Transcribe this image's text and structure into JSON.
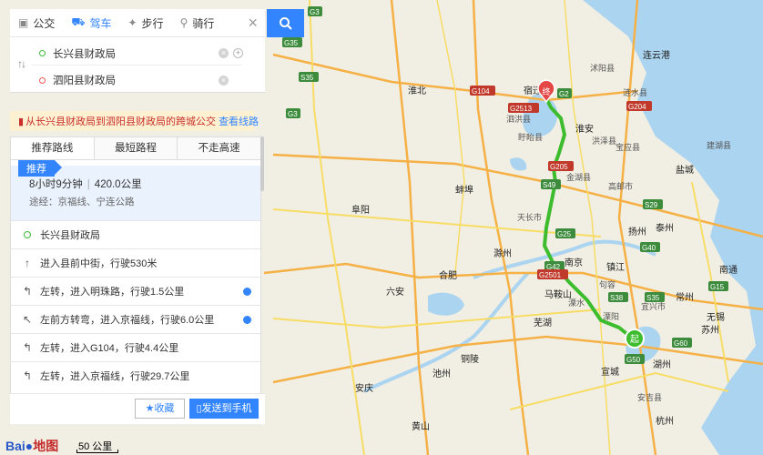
{
  "tabs": [
    {
      "label": "公交",
      "icon": "bus-icon",
      "active": false
    },
    {
      "label": "驾车",
      "icon": "car-icon",
      "active": true
    },
    {
      "label": "步行",
      "icon": "walk-icon",
      "active": false
    },
    {
      "label": "骑行",
      "icon": "bike-icon",
      "active": false
    }
  ],
  "origin": "长兴县财政局",
  "destination": "泗阳县财政局",
  "notice": {
    "text": "从长兴县财政局到泗阳县财政局的跨城公交",
    "link": "查看线路"
  },
  "route_options": [
    "推荐路线",
    "最短路程",
    "不走高速"
  ],
  "recommended": {
    "badge": "推荐",
    "duration": "8小时9分钟",
    "distance": "420.0公里",
    "via": "途经：京福线、宁连公路"
  },
  "steps": [
    {
      "text": "长兴县财政局",
      "icon": "start-dot"
    },
    {
      "text": "进入县前中街，行驶530米",
      "icon": "arrow-up-icon"
    },
    {
      "text": "左转，进入明珠路，行驶1.5公里",
      "icon": "turn-left-icon"
    },
    {
      "text": "左前方转弯，进入京福线，行驶6.0公里",
      "icon": "turn-left-front-icon"
    },
    {
      "text": "左转，进入G104，行驶4.4公里",
      "icon": "turn-left-icon"
    },
    {
      "text": "左转，进入京福线，行驶29.7公里",
      "icon": "turn-left-icon"
    }
  ],
  "actions": {
    "favorite": "收藏",
    "send": "发送到手机"
  },
  "logo": {
    "text": "Bai",
    "text2": "地图"
  },
  "scale": "50 公里",
  "markers": {
    "start": "起",
    "end": "终"
  },
  "map_labels": [
    {
      "text": "南京",
      "kind": "city"
    },
    {
      "text": "镇江",
      "kind": "city"
    },
    {
      "text": "常州",
      "kind": "city"
    },
    {
      "text": "无锡",
      "kind": "city"
    },
    {
      "text": "苏州",
      "kind": "city"
    },
    {
      "text": "扬州",
      "kind": "city"
    },
    {
      "text": "泰州",
      "kind": "city"
    },
    {
      "text": "马鞍山",
      "kind": "city"
    },
    {
      "text": "芜湖",
      "kind": "city"
    },
    {
      "text": "合肥",
      "kind": "city"
    },
    {
      "text": "淮安",
      "kind": "city"
    },
    {
      "text": "宿迁",
      "kind": "city"
    },
    {
      "text": "盐城",
      "kind": "city"
    },
    {
      "text": "阜阳",
      "kind": "city"
    },
    {
      "text": "蚌埠",
      "kind": "city"
    },
    {
      "text": "滁州",
      "kind": "city"
    },
    {
      "text": "湖州",
      "kind": "city"
    },
    {
      "text": "杭州",
      "kind": "city"
    },
    {
      "text": "宣城",
      "kind": "city"
    },
    {
      "text": "六安",
      "kind": "city"
    },
    {
      "text": "安庆",
      "kind": "city"
    },
    {
      "text": "铜陵",
      "kind": "city"
    },
    {
      "text": "池州",
      "kind": "city"
    },
    {
      "text": "黄山",
      "kind": "city"
    },
    {
      "text": "南通",
      "kind": "city"
    },
    {
      "text": "淮北",
      "kind": "city"
    },
    {
      "text": "泗洪县",
      "kind": "town"
    },
    {
      "text": "盱眙县",
      "kind": "town"
    },
    {
      "text": "洪泽县",
      "kind": "town"
    },
    {
      "text": "宝应县",
      "kind": "town"
    },
    {
      "text": "高邮市",
      "kind": "town"
    },
    {
      "text": "金湖县",
      "kind": "town"
    },
    {
      "text": "天长市",
      "kind": "town"
    },
    {
      "text": "溧阳",
      "kind": "town"
    },
    {
      "text": "宜兴市",
      "kind": "town"
    },
    {
      "text": "安吉县",
      "kind": "town"
    },
    {
      "text": "溧水",
      "kind": "town"
    },
    {
      "text": "句容",
      "kind": "town"
    },
    {
      "text": "建湖县",
      "kind": "town"
    },
    {
      "text": "涟水县",
      "kind": "town"
    },
    {
      "text": "沭阳县",
      "kind": "town"
    },
    {
      "text": "连云港",
      "kind": "city"
    }
  ],
  "road_labels": [
    "G3",
    "G35",
    "S49",
    "G25",
    "G2",
    "G205",
    "G104",
    "G2513",
    "G40",
    "G42",
    "G50",
    "G60",
    "S38",
    "S35",
    "S29",
    "G2501",
    "G204",
    "S35",
    "G15",
    "G3"
  ],
  "colors": {
    "accent": "#3385ff",
    "route": "#3dbd2e",
    "water": "#aad3f0",
    "highway": "#f5b146",
    "road": "#f7dd65"
  }
}
